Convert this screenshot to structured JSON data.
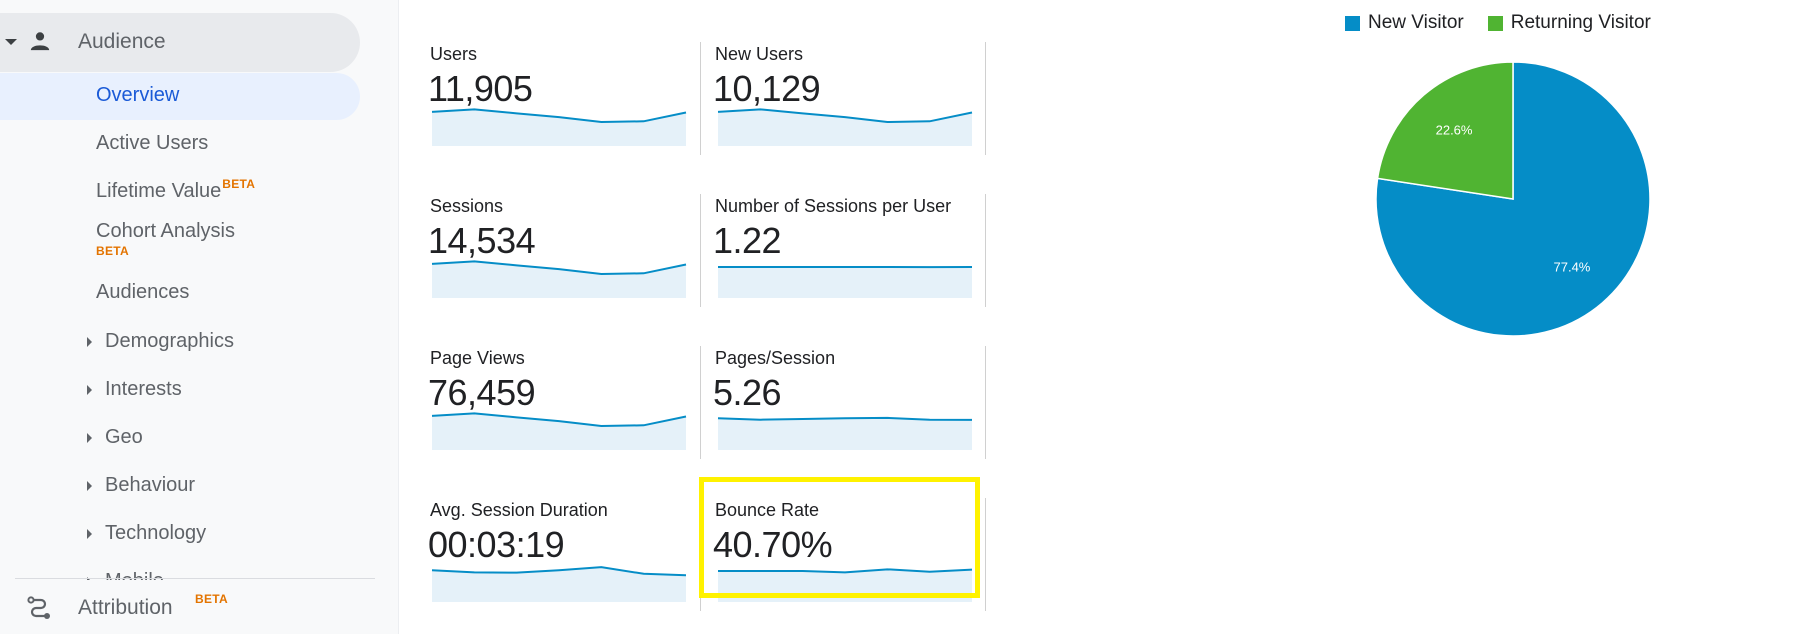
{
  "sidebar": {
    "section": {
      "label": "Audience",
      "icon": "person-icon",
      "expanded": true
    },
    "items": [
      {
        "label": "Overview",
        "active": true
      },
      {
        "label": "Active Users"
      },
      {
        "label": "Lifetime Value",
        "badge": "BETA"
      },
      {
        "label": "Cohort Analysis",
        "badge": "BETA"
      },
      {
        "label": "Audiences"
      }
    ],
    "expandable": [
      {
        "label": "Demographics"
      },
      {
        "label": "Interests"
      },
      {
        "label": "Geo"
      },
      {
        "label": "Behaviour"
      },
      {
        "label": "Technology"
      },
      {
        "label": "Mobile"
      }
    ],
    "footer": {
      "label": "Attribution",
      "badge": "BETA",
      "icon": "attribution-icon"
    }
  },
  "metrics": [
    {
      "label": "Users",
      "value": "11,905",
      "trend": [
        0.72,
        0.9,
        0.62,
        0.35,
        0.0,
        0.05,
        0.68
      ]
    },
    {
      "label": "New Users",
      "value": "10,129",
      "trend": [
        0.72,
        0.9,
        0.62,
        0.35,
        0.0,
        0.05,
        0.68
      ]
    },
    {
      "label": "Sessions",
      "value": "14,534",
      "trend": [
        0.72,
        0.9,
        0.62,
        0.35,
        0.0,
        0.05,
        0.68
      ]
    },
    {
      "label": "Number of Sessions per User",
      "value": "1.22",
      "trend": [
        0.5,
        0.5,
        0.5,
        0.5,
        0.5,
        0.49,
        0.5
      ]
    },
    {
      "label": "Page Views",
      "value": "76,459",
      "trend": [
        0.72,
        0.9,
        0.62,
        0.35,
        0.0,
        0.05,
        0.68
      ]
    },
    {
      "label": "Pages/Session",
      "value": "5.26",
      "trend": [
        0.55,
        0.45,
        0.5,
        0.55,
        0.58,
        0.45,
        0.44
      ]
    },
    {
      "label": "Avg. Session Duration",
      "value": "00:03:19",
      "trend": [
        0.55,
        0.4,
        0.38,
        0.55,
        0.78,
        0.3,
        0.2
      ]
    },
    {
      "label": "Bounce Rate",
      "value": "40.70%",
      "trend": [
        0.5,
        0.5,
        0.5,
        0.4,
        0.62,
        0.45,
        0.6
      ],
      "highlighted": true
    }
  ],
  "chart_data": {
    "type": "pie",
    "title": "",
    "legend_position": "top",
    "series": [
      {
        "name": "New Visitor",
        "value": 77.4,
        "label": "77.4%",
        "color": "#058dc7"
      },
      {
        "name": "Returning Visitor",
        "value": 22.6,
        "label": "22.6%",
        "color": "#50b432"
      }
    ]
  },
  "colors": {
    "spark_line": "#058dc7",
    "spark_fill": "#e5f1f9",
    "highlight": "#fff200",
    "beta": "#e37400",
    "active_nav": "#1a5ad7"
  }
}
